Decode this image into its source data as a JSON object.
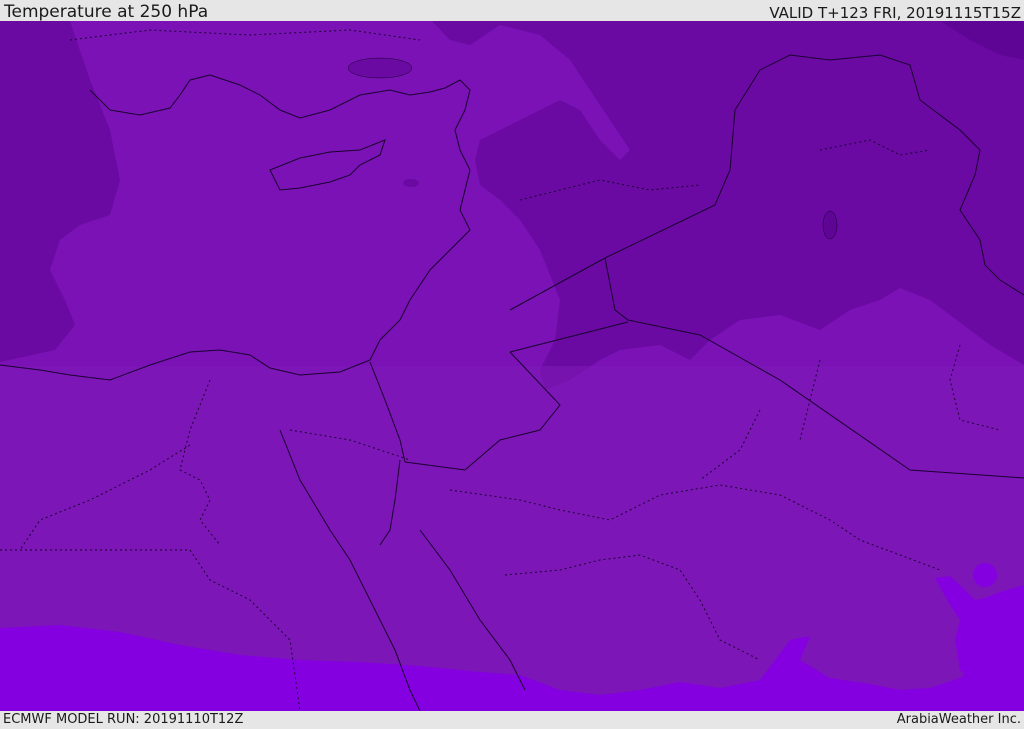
{
  "header": {
    "title": "Temperature at 250 hPa",
    "valid": "VALID T+123 FRI, 20191115T15Z"
  },
  "footer": {
    "model_run": "ECMWF MODEL RUN: 20191110T12Z",
    "credit": "ArabiaWeather Inc."
  },
  "map": {
    "field": "Temperature at 250 hPa",
    "colors": {
      "darkest": "#5e0596",
      "dark": "#6a0aa2",
      "medium": "#7b12b5",
      "light": "#7f19b6",
      "bright": "#8400e0",
      "border": "#1a0030"
    }
  }
}
